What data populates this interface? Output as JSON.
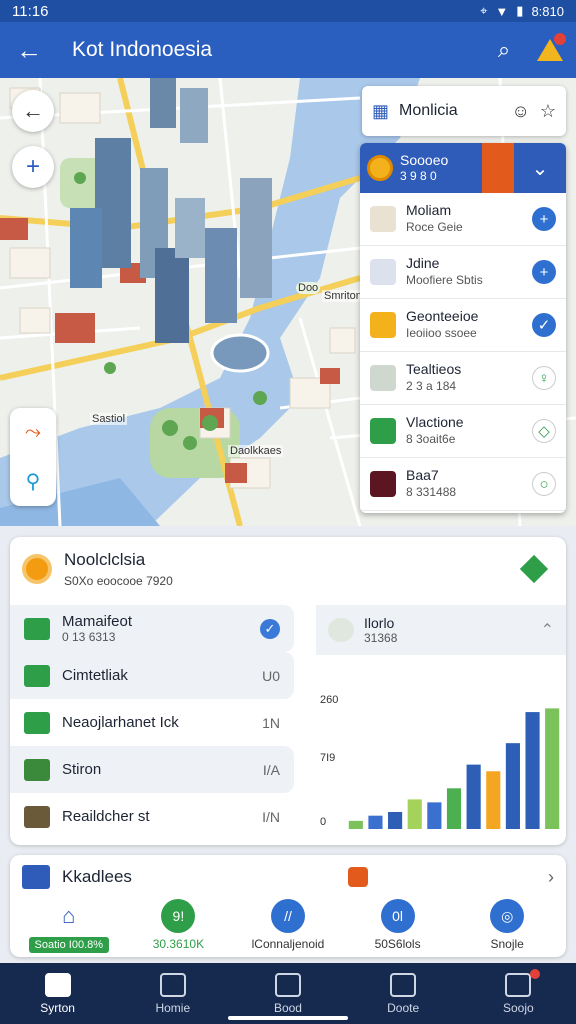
{
  "status_bar": {
    "time": "11:16",
    "right_text": "8:810"
  },
  "app_bar": {
    "title": "Kot Indonoesia"
  },
  "map": {
    "labels": [
      "Sastiol",
      "Daolkkaes",
      "Smriton"
    ],
    "pin_label": "Doo"
  },
  "overlay": {
    "header_label": "Monlicia",
    "top_item": {
      "title": "Soooeo",
      "subtitle": "3 9 8 0"
    },
    "items": [
      {
        "title": "Moliam",
        "subtitle": "Roce Geie",
        "action": "+",
        "icon_color": "#e9e1d2"
      },
      {
        "title": "Jdine",
        "subtitle": "Moofiere Sbtis",
        "action": "+",
        "icon_color": "#dbe2ee"
      },
      {
        "title": "Geonteeioe",
        "subtitle": "Ieoiioo ssoee",
        "action": "✓",
        "icon_color": "#f3b21c"
      },
      {
        "title": "Tealtieos",
        "subtitle": "2 3 a 184",
        "action": "♀",
        "icon_color": "#cfd8cf"
      },
      {
        "title": "Vlactione",
        "subtitle": "8 3oait6e",
        "action": "◇",
        "icon_color": "#2e9e49"
      },
      {
        "title": "Baa7",
        "subtitle": "8 331488",
        "action": "○",
        "icon_color": "#5b1621"
      }
    ]
  },
  "stats": {
    "title": "Noolclclsia",
    "subtitle": "S0Xo eoocooe 7920",
    "categories": [
      {
        "label": "Mamaifeot",
        "sub": "0 13 6313",
        "value": "",
        "checked": true,
        "shade": true,
        "icon": "#2e9e49"
      },
      {
        "label": "Cimtetliak",
        "sub": "",
        "value": "U0",
        "checked": false,
        "shade": true,
        "icon": "#2e9e49"
      },
      {
        "label": "Neaojlarhanet Ick",
        "sub": "",
        "value": "1N",
        "checked": false,
        "shade": false,
        "icon": "#2e9e49"
      },
      {
        "label": "Stiron",
        "sub": "",
        "value": "I/A",
        "checked": false,
        "shade": true,
        "icon": "#3b8a3b"
      },
      {
        "label": "Reaildcher st",
        "sub": "",
        "value": "I/N",
        "checked": false,
        "shade": false,
        "icon": "#6b5a3a"
      }
    ],
    "chart_header": {
      "title": "Ilorlo",
      "subtitle": "31368"
    }
  },
  "chart_data": {
    "type": "bar",
    "y_ticks": [
      "260",
      "7I9",
      "0"
    ],
    "values": [
      11,
      18,
      23,
      40,
      36,
      55,
      87,
      78,
      116,
      158,
      163
    ],
    "colors": [
      "#7cc25a",
      "#3b6fd0",
      "#2d5fb7",
      "#a5d25a",
      "#3b6fd0",
      "#4caf50",
      "#2d5fb7",
      "#f4a522",
      "#2d5fb7",
      "#2d5fb7",
      "#7cc25a"
    ],
    "ylim": [
      0,
      200
    ],
    "grid": false
  },
  "bottom_card": {
    "title": "Kkadlees",
    "quick": [
      {
        "circle_text": "",
        "circle_color": "",
        "label": "Soatio I00.8%",
        "style": "pill"
      },
      {
        "circle_text": "9!",
        "circle_color": "#2e9e49",
        "label": "30.3610K",
        "style": "green"
      },
      {
        "circle_text": "//",
        "circle_color": "#2f6fd0",
        "label": "lConnaljenoid",
        "style": "plain"
      },
      {
        "circle_text": "0l",
        "circle_color": "#2f6fd0",
        "label": "50S6lols",
        "style": "plain"
      },
      {
        "circle_text": "◎",
        "circle_color": "#2f6fd0",
        "label": "Snojle",
        "style": "plain"
      }
    ]
  },
  "nav": [
    {
      "label": "Syrton",
      "active": true
    },
    {
      "label": "Homie",
      "active": false
    },
    {
      "label": "Bood",
      "active": false
    },
    {
      "label": "Doote",
      "active": false
    },
    {
      "label": "Soojo",
      "active": false
    }
  ]
}
